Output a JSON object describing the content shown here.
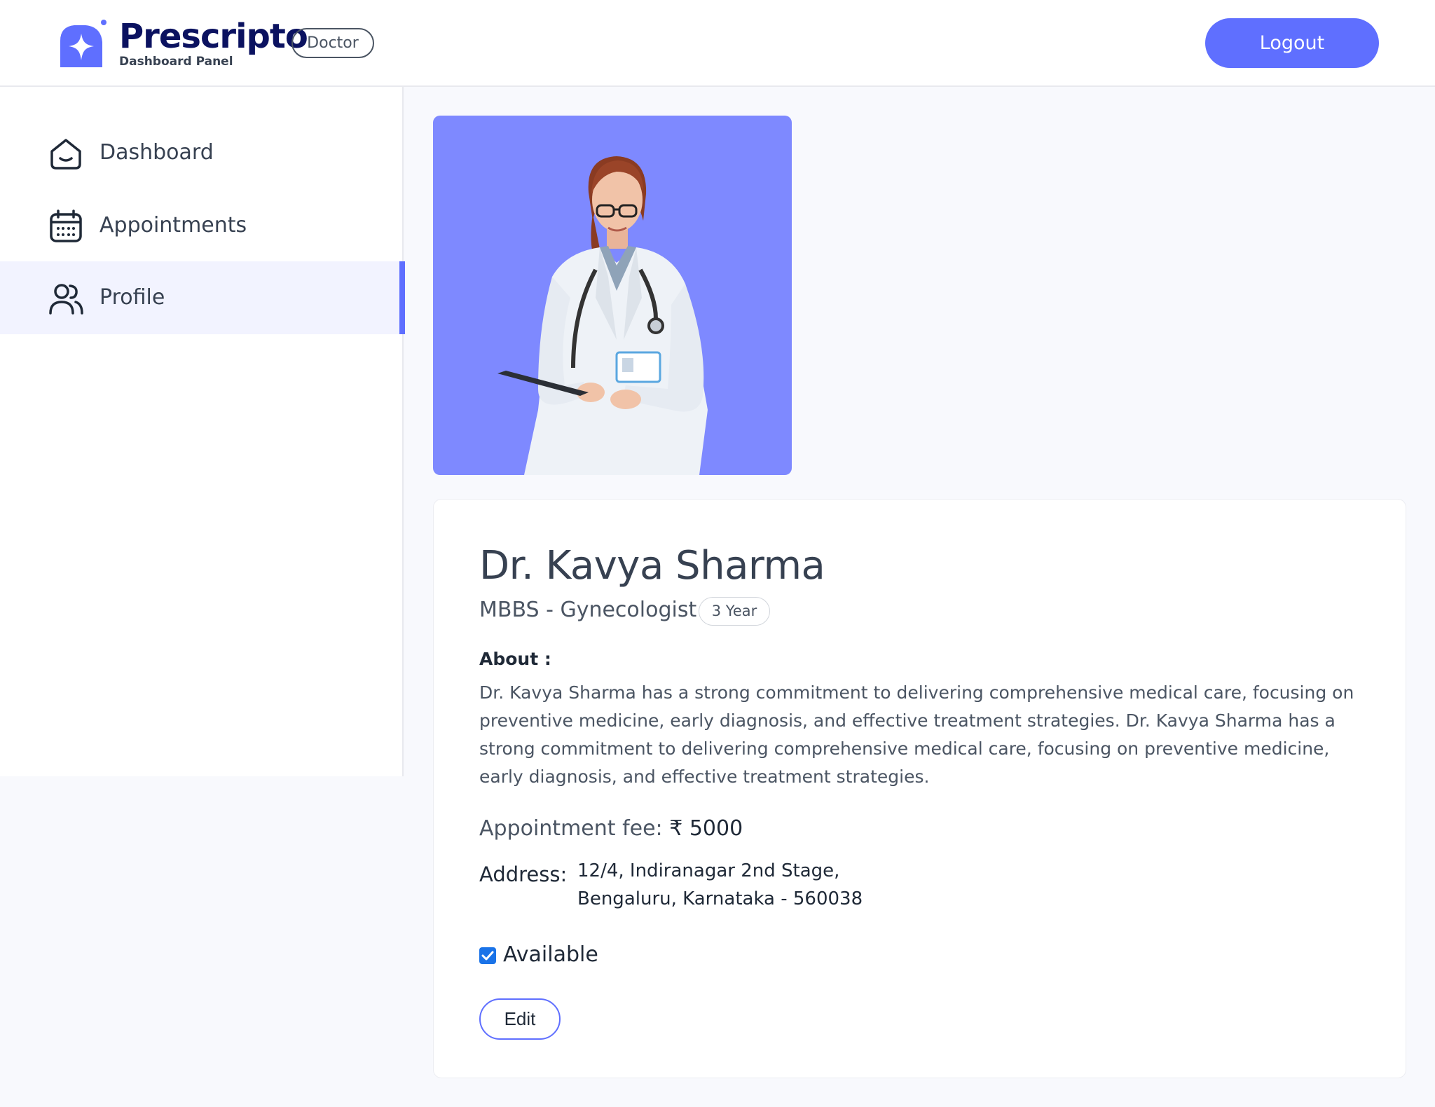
{
  "header": {
    "brand": "Prescripto",
    "brand_sub": "Dashboard Panel",
    "role_badge": "Doctor",
    "logout_label": "Logout"
  },
  "sidebar": {
    "items": [
      {
        "label": "Dashboard",
        "icon": "home-icon",
        "active": false
      },
      {
        "label": "Appointments",
        "icon": "calendar-icon",
        "active": false
      },
      {
        "label": "Profile",
        "icon": "people-icon",
        "active": true
      }
    ]
  },
  "profile": {
    "photo_alt": "doctor-photo",
    "name": "Dr. Kavya Sharma",
    "degree": "MBBS - Gynecologist",
    "experience": "3 Year",
    "about_title": "About :",
    "about_text": "Dr. Kavya Sharma has a strong commitment to delivering comprehensive medical care, focusing on preventive medicine, early diagnosis, and effective treatment strategies. Dr. Kavya Sharma has a strong commitment to delivering comprehensive medical care, focusing on preventive medicine, early diagnosis, and effective treatment strategies.",
    "fee_label": "Appointment fee:",
    "fee_value": "₹ 5000",
    "address_label": "Address:",
    "address_line1": "12/4, Indiranagar 2nd Stage,",
    "address_line2": "Bengaluru, Karnataka - 560038",
    "available_label": "Available",
    "available_checked": true,
    "edit_label": "Edit"
  },
  "colors": {
    "accent": "#5f6fff",
    "photo_bg": "#7e89ff",
    "brand_text": "#0b1260",
    "active_nav_bg": "#f2f3ff"
  }
}
